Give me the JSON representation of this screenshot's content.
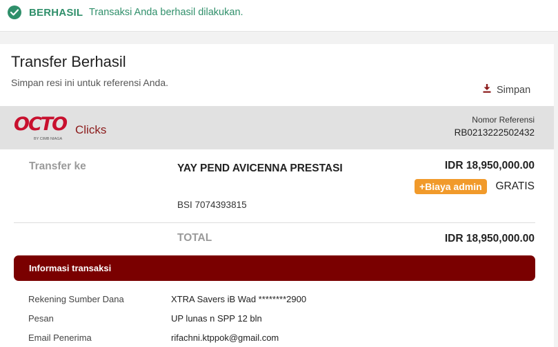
{
  "banner": {
    "status": "BERHASIL",
    "message": "Transaksi Anda berhasil dilakukan.",
    "icon": "check-circle-icon",
    "color": "#2f8f6a"
  },
  "header": {
    "title": "Transfer Berhasil",
    "subtitle": "Simpan resi ini untuk referensi Anda.",
    "save_label": "Simpan",
    "save_icon": "download-icon"
  },
  "brand": {
    "logo_text": "OCTO",
    "logo_suffix": "Clicks",
    "byline": "BY CIMB NIAGA",
    "color": "#c8102e"
  },
  "reference": {
    "label": "Nomor Referensi",
    "value": "RB0213222502432"
  },
  "transfer": {
    "label": "Transfer ke",
    "payee": "YAY PEND AVICENNA PRESTASI",
    "account": "BSI 7074393815",
    "amount": "IDR 18,950,000.00",
    "fee_label": "+Biaya admin",
    "fee_value": "GRATIS",
    "fee_color": "#f19a2b"
  },
  "total": {
    "label": "TOTAL",
    "value": "IDR 18,950,000.00"
  },
  "info": {
    "title": "Informasi transaksi",
    "color": "#7a0000",
    "rows": [
      {
        "label": "Rekening Sumber Dana",
        "value": "XTRA Savers iB Wad ********2900"
      },
      {
        "label": "Pesan",
        "value": "UP lunas n SPP 12 bln"
      },
      {
        "label": "Email Penerima",
        "value": "rifachni.ktppok@gmail.com"
      }
    ]
  }
}
